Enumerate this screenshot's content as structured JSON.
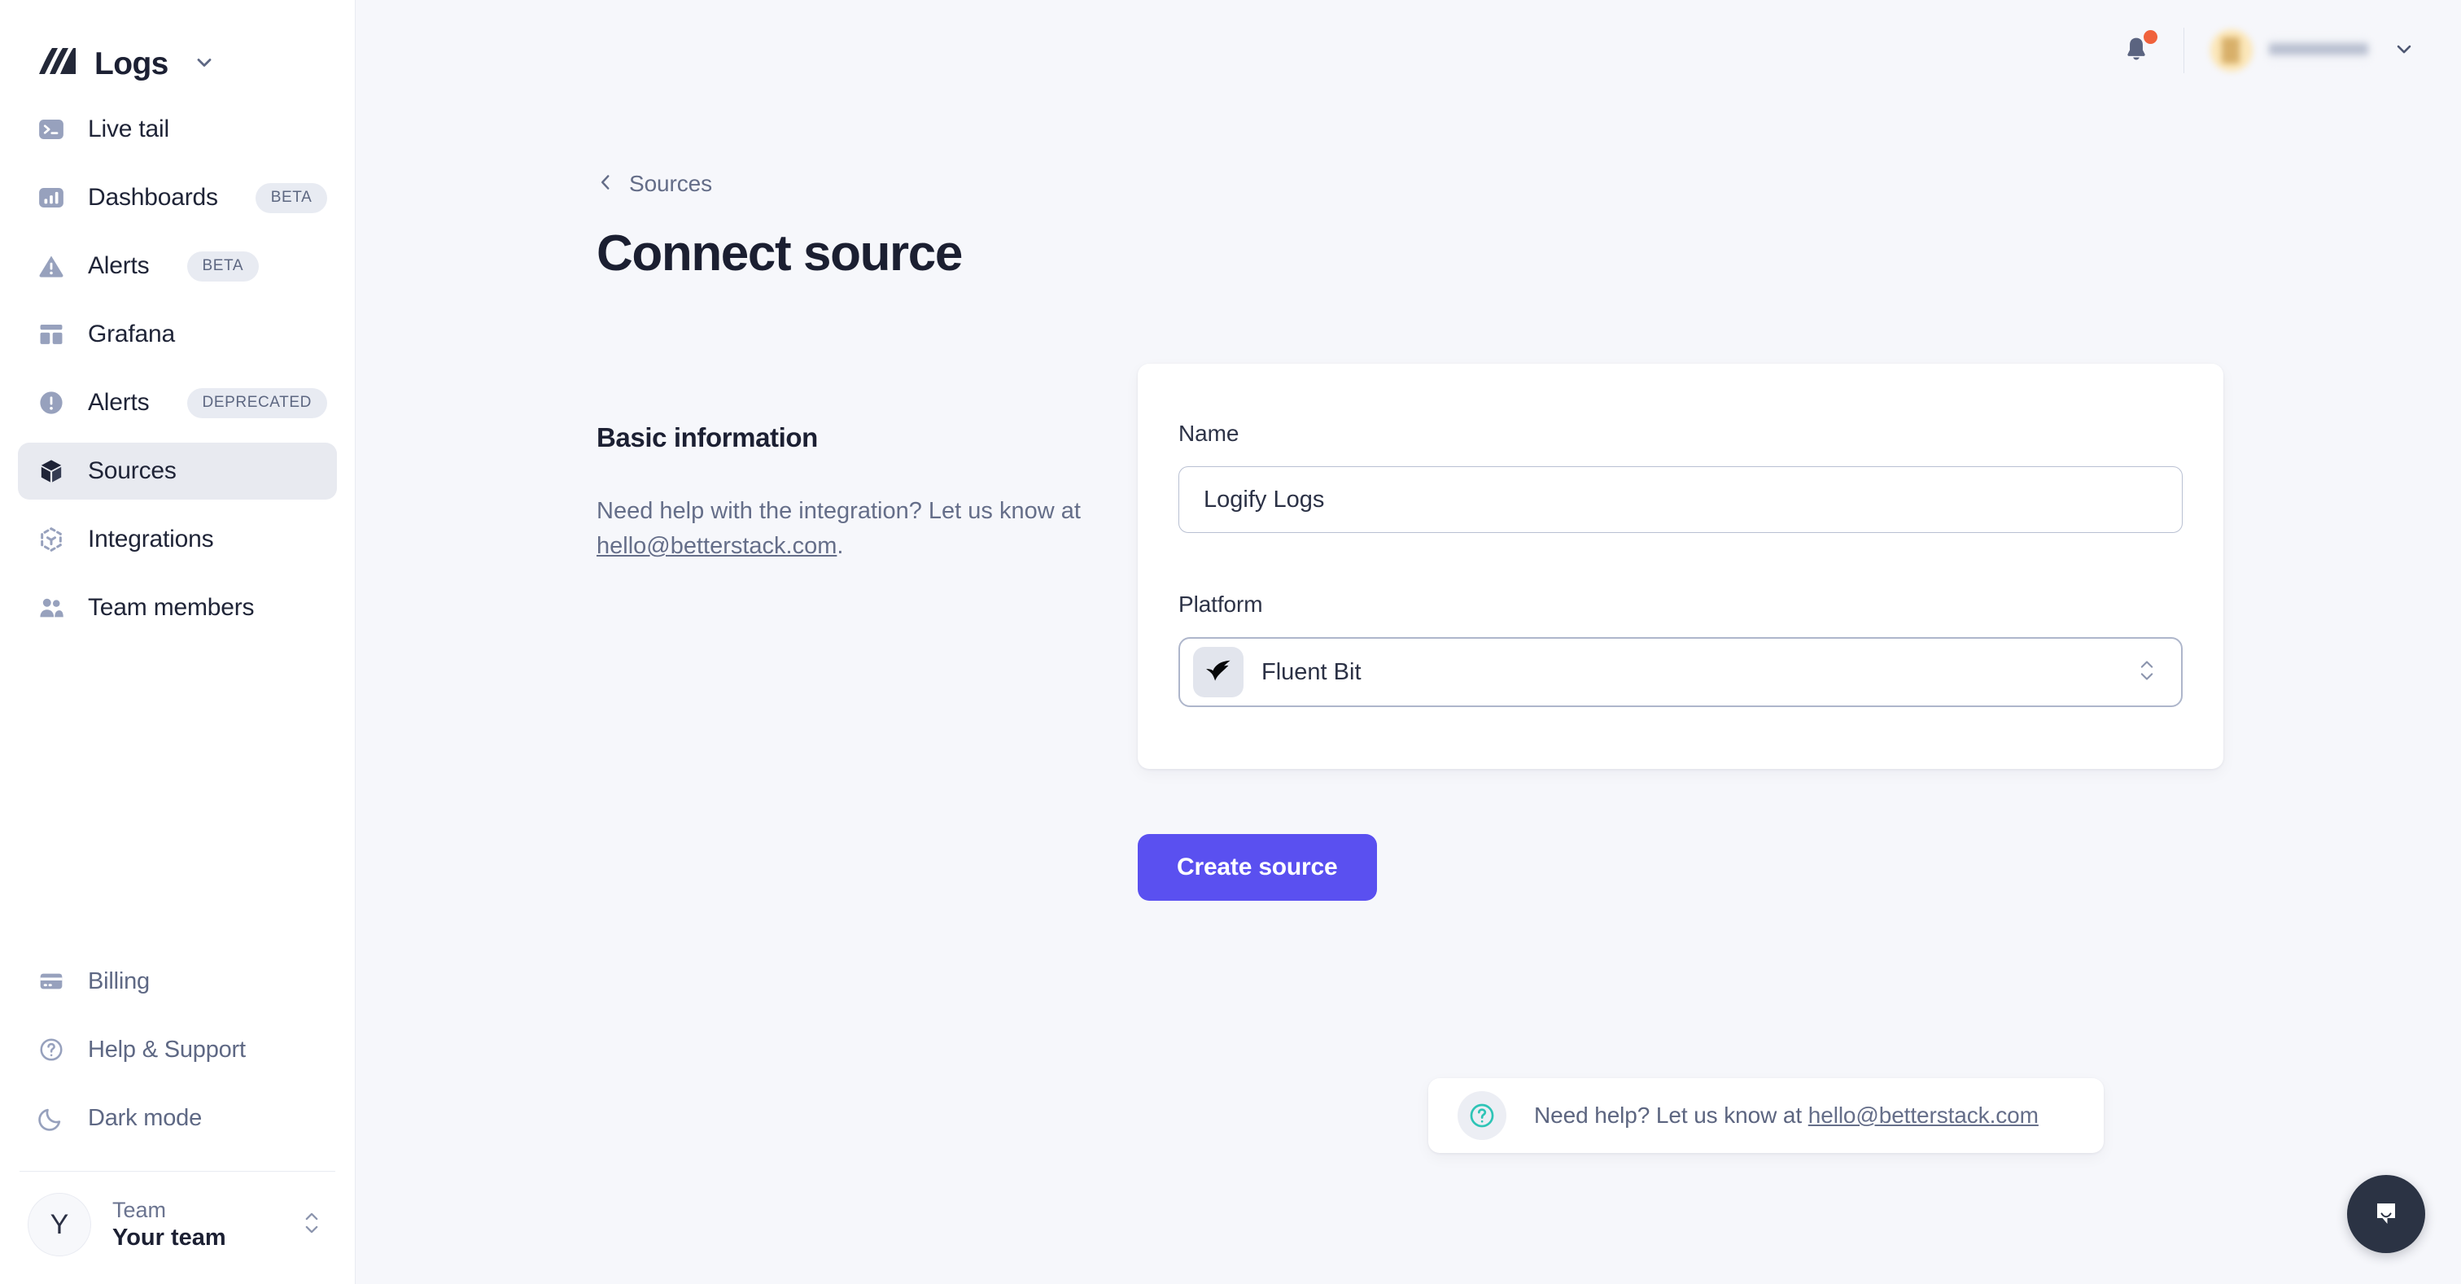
{
  "sidebar": {
    "brand": {
      "title": "Logs",
      "logo_icon": "betterstack-logo-icon",
      "chevron_icon": "chevron-down-icon"
    },
    "items": [
      {
        "label": "Live tail",
        "icon": "terminal-icon",
        "badge": "",
        "active": false
      },
      {
        "label": "Dashboards",
        "icon": "bar-chart-icon",
        "badge": "BETA",
        "active": false
      },
      {
        "label": "Alerts",
        "icon": "warning-triangle-icon",
        "badge": "BETA",
        "active": false
      },
      {
        "label": "Grafana",
        "icon": "dashboard-grid-icon",
        "badge": "",
        "active": false
      },
      {
        "label": "Alerts",
        "icon": "exclamation-circle-icon",
        "badge": "DEPRECATED",
        "active": false
      },
      {
        "label": "Sources",
        "icon": "cube-icon",
        "badge": "",
        "active": true
      },
      {
        "label": "Integrations",
        "icon": "hexagon-nodes-icon",
        "badge": "",
        "active": false
      },
      {
        "label": "Team members",
        "icon": "users-icon",
        "badge": "",
        "active": false
      }
    ],
    "bottom_items": [
      {
        "label": "Billing",
        "icon": "credit-card-icon"
      },
      {
        "label": "Help & Support",
        "icon": "question-circle-icon"
      },
      {
        "label": "Dark mode",
        "icon": "moon-icon"
      }
    ],
    "team": {
      "avatar_initial": "Y",
      "kicker": "Team",
      "name": "Your team",
      "stepper_icon": "chevron-up-down-icon"
    }
  },
  "topbar": {
    "bell_icon": "bell-icon",
    "bell_has_unread": true,
    "unread_dot_color": "#f0623c",
    "avatar_icon": "user-avatar",
    "user_name": "",
    "chevron_icon": "chevron-down-icon"
  },
  "breadcrumb": {
    "back_icon": "chevron-left-icon",
    "label": "Sources"
  },
  "page": {
    "title": "Connect source"
  },
  "basic_info": {
    "heading": "Basic information",
    "description_before": "Need help with the integration? Let us know at ",
    "email": "hello@betterstack.com",
    "description_after": "."
  },
  "form": {
    "name": {
      "label": "Name",
      "value": "Logify Logs",
      "placeholder": "Source name"
    },
    "platform": {
      "label": "Platform",
      "value": "Fluent Bit",
      "icon": "fluent-bit-logo-icon",
      "stepper_icon": "chevron-up-down-icon"
    },
    "submit_label": "Create source"
  },
  "help_card": {
    "icon": "question-circle-icon",
    "text_before": "Need help? Let us know at ",
    "email": "hello@betterstack.com"
  },
  "chat": {
    "icon": "intercom-chat-icon"
  },
  "colors": {
    "accent": "#5a50f0",
    "page_bg": "#f6f7fb",
    "sidebar_bg": "#ffffff",
    "sidebar_active_bg": "#e8eaf0",
    "icon_muted": "#97a1bd",
    "text_primary": "#1f2437",
    "text_muted": "#656e89",
    "badge_bg": "#e8ebf2",
    "help_icon": "#2ec4b6",
    "notification_dot": "#f0623c",
    "chat_bg": "#2b3344"
  }
}
